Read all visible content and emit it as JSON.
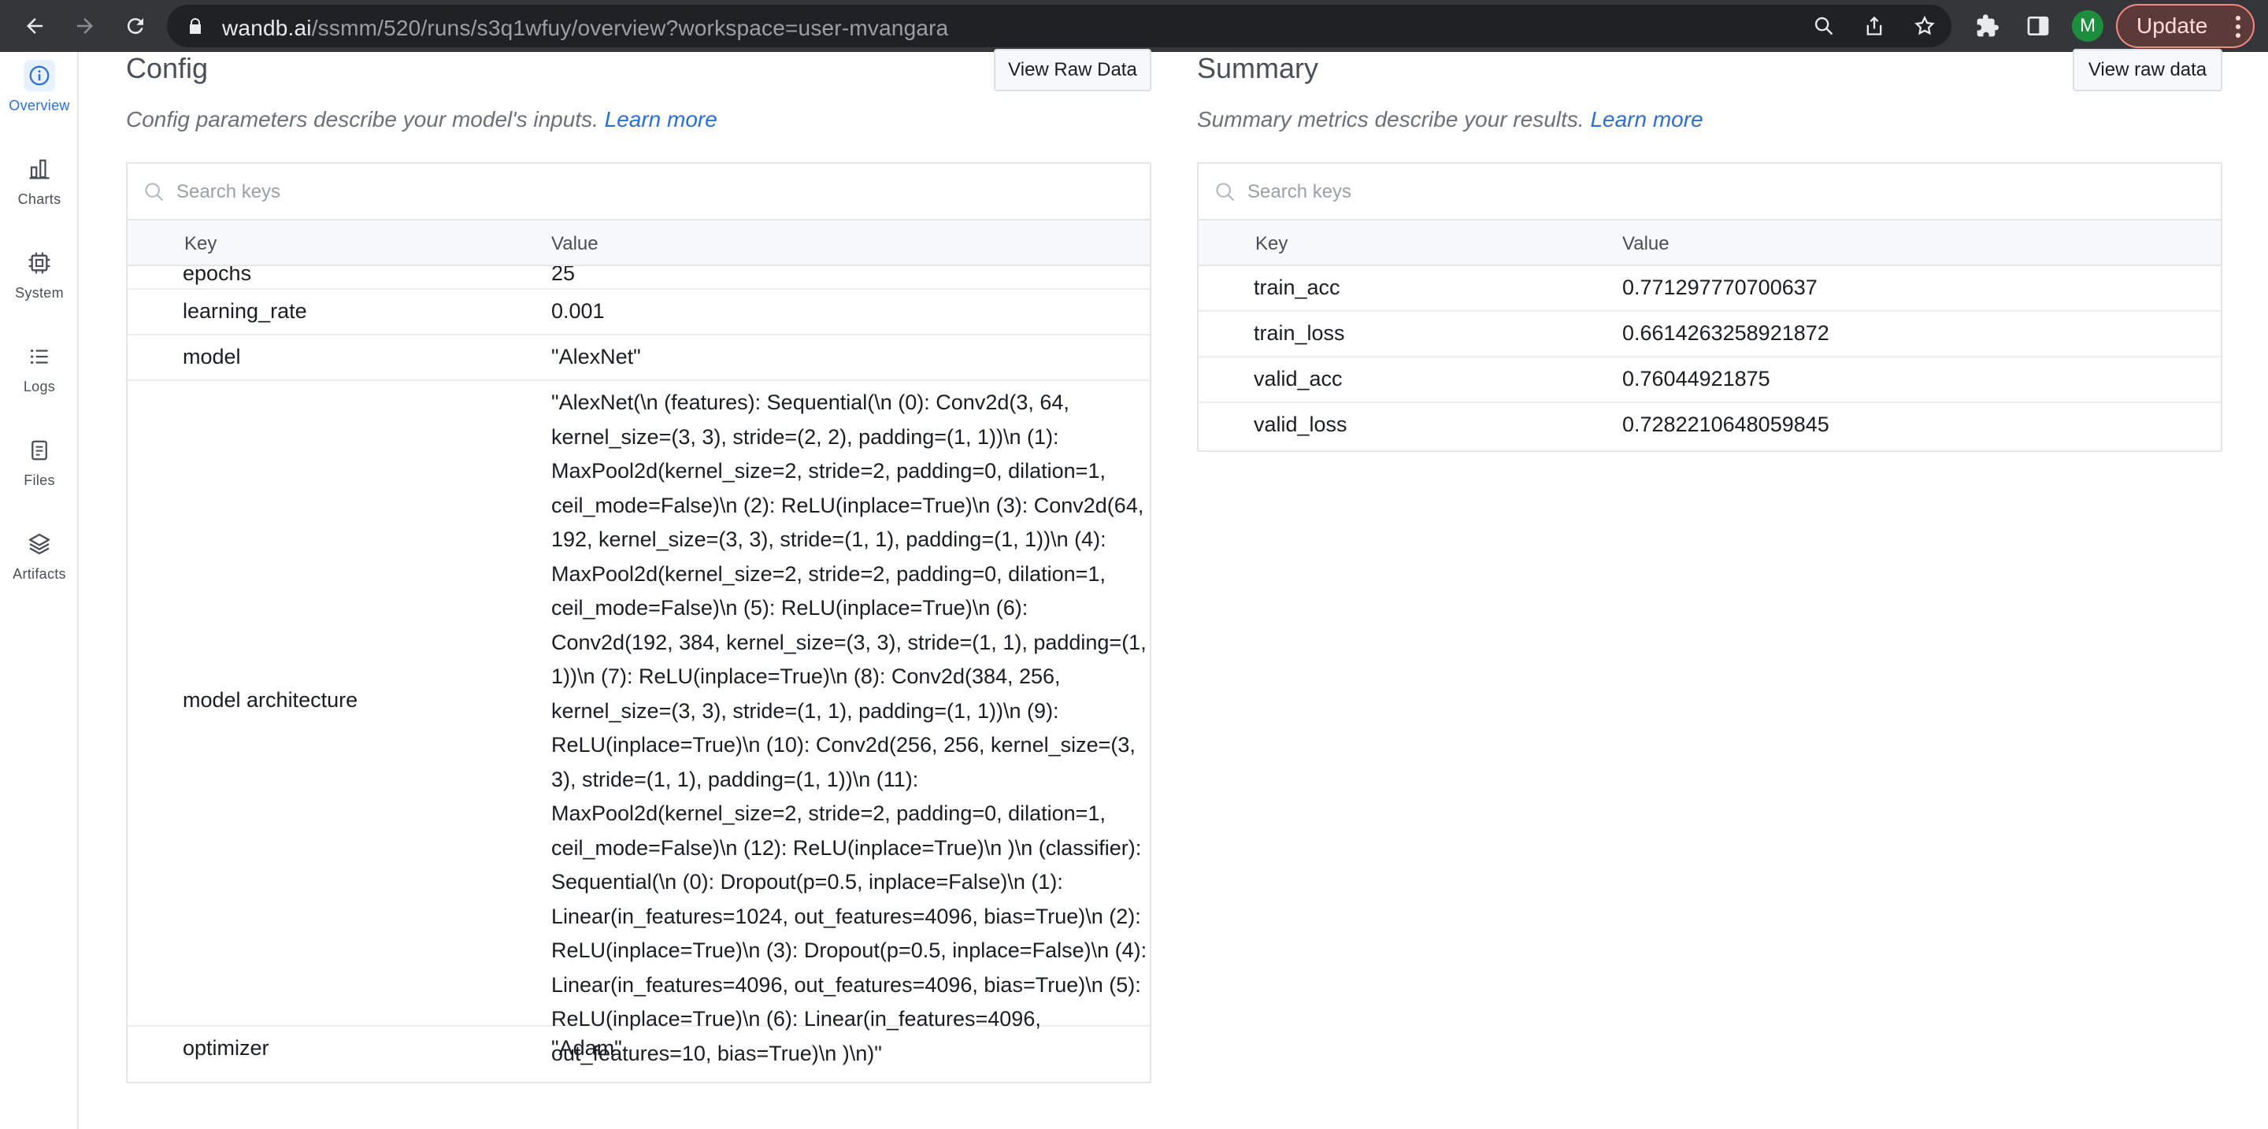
{
  "browser": {
    "url_host": "wandb.ai",
    "url_path": "/ssmm/520/runs/s3q1wfuy/overview?workspace=user-mvangara",
    "profile_initial": "M",
    "update_label": "Update"
  },
  "sidebar": {
    "items": [
      {
        "label": "Overview",
        "icon": "info-icon"
      },
      {
        "label": "Charts",
        "icon": "bar-chart-icon"
      },
      {
        "label": "System",
        "icon": "cpu-icon"
      },
      {
        "label": "Logs",
        "icon": "list-icon"
      },
      {
        "label": "Files",
        "icon": "file-icon"
      },
      {
        "label": "Artifacts",
        "icon": "layers-icon"
      }
    ]
  },
  "config": {
    "title": "Config",
    "raw_button": "View Raw Data",
    "description": "Config parameters describe your model's inputs.",
    "learn_more": "Learn more",
    "search_placeholder": "Search keys",
    "col_key": "Key",
    "col_value": "Value",
    "rows": [
      {
        "key": "epochs",
        "value": "25"
      },
      {
        "key": "learning_rate",
        "value": "0.001"
      },
      {
        "key": "model",
        "value": "\"AlexNet\""
      },
      {
        "key": "model architecture",
        "value": "\"AlexNet(\\n (features): Sequential(\\n (0): Conv2d(3, 64, kernel_size=(3, 3), stride=(2, 2), padding=(1, 1))\\n (1): MaxPool2d(kernel_size=2, stride=2, padding=0, dilation=1, ceil_mode=False)\\n (2): ReLU(inplace=True)\\n (3): Conv2d(64, 192, kernel_size=(3, 3), stride=(1, 1), padding=(1, 1))\\n (4): MaxPool2d(kernel_size=2, stride=2, padding=0, dilation=1, ceil_mode=False)\\n (5): ReLU(inplace=True)\\n (6): Conv2d(192, 384, kernel_size=(3, 3), stride=(1, 1), padding=(1, 1))\\n (7): ReLU(inplace=True)\\n (8): Conv2d(384, 256, kernel_size=(3, 3), stride=(1, 1), padding=(1, 1))\\n (9): ReLU(inplace=True)\\n (10): Conv2d(256, 256, kernel_size=(3, 3), stride=(1, 1), padding=(1, 1))\\n (11): MaxPool2d(kernel_size=2, stride=2, padding=0, dilation=1, ceil_mode=False)\\n (12): ReLU(inplace=True)\\n )\\n (classifier): Sequential(\\n (0): Dropout(p=0.5, inplace=False)\\n (1): Linear(in_features=1024, out_features=4096, bias=True)\\n (2): ReLU(inplace=True)\\n (3): Dropout(p=0.5, inplace=False)\\n (4): Linear(in_features=4096, out_features=4096, bias=True)\\n (5): ReLU(inplace=True)\\n (6): Linear(in_features=4096, out_features=10, bias=True)\\n )\\n)\""
      },
      {
        "key": "optimizer",
        "value": "\"Adam\""
      }
    ]
  },
  "summary": {
    "title": "Summary",
    "raw_button": "View raw data",
    "description": "Summary metrics describe your results.",
    "learn_more": "Learn more",
    "search_placeholder": "Search keys",
    "col_key": "Key",
    "col_value": "Value",
    "rows": [
      {
        "key": "train_acc",
        "value": "0.771297770700637"
      },
      {
        "key": "train_loss",
        "value": "0.6614263258921872"
      },
      {
        "key": "valid_acc",
        "value": "0.76044921875"
      },
      {
        "key": "valid_loss",
        "value": "0.7282210648059845"
      }
    ]
  },
  "colors": {
    "accent": "#2b6fd6",
    "chrome": "#35363a",
    "border": "#e6e6e6"
  }
}
